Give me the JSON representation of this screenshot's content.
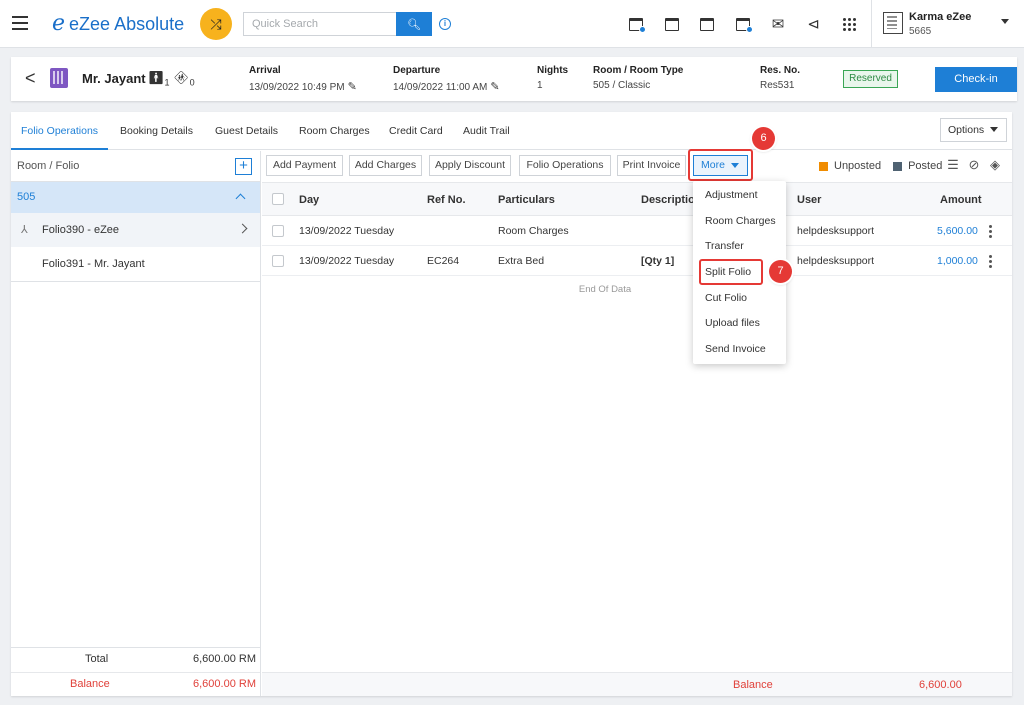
{
  "header": {
    "logo_mark": "e",
    "logo_text": "eZee Absolute",
    "search_placeholder": "Quick Search",
    "info_glyph": "i",
    "user_name": "Karma eZee",
    "user_code": "5665",
    "icons": [
      "calendar-add-icon",
      "calendar-check-icon",
      "calendar-icon",
      "calendar-badge-icon",
      "mail-icon",
      "megaphone-icon",
      "apps-grid-icon"
    ]
  },
  "guest": {
    "name": "Mr. Jayant",
    "adults": "1",
    "children": "0",
    "arrival_label": "Arrival",
    "arrival_value": "13/09/2022 10:49 PM",
    "departure_label": "Departure",
    "departure_value": "14/09/2022 11:00 AM",
    "nights_label": "Nights",
    "nights_value": "1",
    "room_label": "Room / Room Type",
    "room_value": "505 / Classic",
    "resno_label": "Res. No.",
    "resno_value": "Res531",
    "status": "Reserved",
    "checkin_label": "Check-in"
  },
  "tabs": [
    "Folio Operations",
    "Booking Details",
    "Guest Details",
    "Room Charges",
    "Credit Card",
    "Audit Trail"
  ],
  "options_label": "Options",
  "left": {
    "title": "Room / Folio",
    "room": "505",
    "folios": [
      "Folio390 - eZee",
      "Folio391 - Mr. Jayant"
    ],
    "total_label": "Total",
    "total_value": "6,600.00 RM",
    "balance_label": "Balance",
    "balance_value": "6,600.00 RM"
  },
  "toolbar": {
    "buttons": [
      "Add Payment",
      "Add Charges",
      "Apply Discount",
      "Folio Operations",
      "Print Invoice"
    ],
    "more_label": "More",
    "legend_unposted": "Unposted",
    "legend_posted": "Posted"
  },
  "colors": {
    "accent": "#1e7fd6",
    "unposted": "#f08c00",
    "posted": "#4f6272",
    "balance": "#e0413a",
    "annotation": "#e53935"
  },
  "table": {
    "headers": [
      "Day",
      "Ref No.",
      "Particulars",
      "Description",
      "User",
      "Amount"
    ],
    "rows": [
      {
        "day": "13/09/2022 Tuesday",
        "ref": "",
        "particulars": "Room Charges",
        "description": "",
        "user": "helpdesksupport",
        "amount": "5,600.00"
      },
      {
        "day": "13/09/2022 Tuesday",
        "ref": "EC264",
        "particulars": "Extra Bed",
        "description": "[Qty 1]",
        "user": "helpdesksupport",
        "amount": "1,000.00"
      }
    ],
    "end_text": "End Of Data",
    "balance_label": "Balance",
    "balance_value": "6,600.00"
  },
  "dropdown": [
    "Adjustment",
    "Room Charges",
    "Transfer",
    "Split Folio",
    "Cut Folio",
    "Upload files",
    "Send Invoice"
  ],
  "steps": [
    "6",
    "7"
  ]
}
